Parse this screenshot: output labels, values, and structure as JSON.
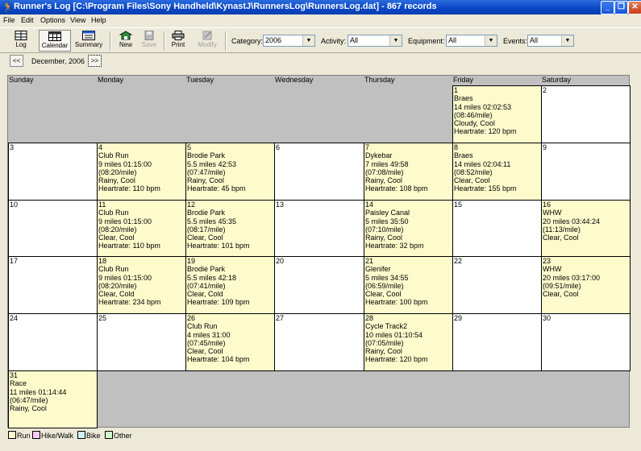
{
  "window": {
    "title": "Runner's Log [C:\\Program Files\\Sony Handheld\\KynastJ\\RunnersLog\\RunnersLog.dat] - 867 records",
    "minimize_glyph": "_",
    "maximize_glyph": "❐",
    "close_glyph": "✕"
  },
  "menu": [
    "File",
    "Edit",
    "Options",
    "View",
    "Help"
  ],
  "toolbar": {
    "log": "Log",
    "calendar": "Calendar",
    "summary": "Summary",
    "new": "New",
    "save": "Save",
    "print": "Print",
    "modify": "Modify"
  },
  "filters": {
    "category_label": "Category:",
    "category_value": "2006",
    "activity_label": "Activity:",
    "activity_value": "All",
    "equipment_label": "Equipment:",
    "equipment_value": "All",
    "events_label": "Events:",
    "events_value": "All"
  },
  "nav": {
    "prev": "<<",
    "next": ">>",
    "month_label": "December, 2006"
  },
  "days_of_week": [
    "Sunday",
    "Monday",
    "Tuesday",
    "Wednesday",
    "Thursday",
    "Friday",
    "Saturday"
  ],
  "weeks": [
    [
      null,
      null,
      null,
      null,
      null,
      {
        "day": "1",
        "run": true,
        "lines": [
          "Braes",
          "14 miles 02:02:53",
          "(08:46/mile)",
          "Cloudy, Cool",
          "Heartrate: 120 bpm"
        ]
      },
      {
        "day": "2",
        "run": false,
        "lines": []
      }
    ],
    [
      {
        "day": "3",
        "run": false,
        "lines": []
      },
      {
        "day": "4",
        "run": true,
        "lines": [
          "Club Run",
          "9 miles 01:15:00",
          "(08:20/mile)",
          "Rainy, Cool",
          "Heartrate: 110 bpm"
        ]
      },
      {
        "day": "5",
        "run": true,
        "lines": [
          "Brodie Park",
          "5.5 miles 42:53",
          "(07:47/mile)",
          "Rainy, Cool",
          "Heartrate: 45 bpm"
        ]
      },
      {
        "day": "6",
        "run": false,
        "lines": []
      },
      {
        "day": "7",
        "run": true,
        "lines": [
          "Dykebar",
          "7 miles 49:58",
          "(07:08/mile)",
          "Rainy, Cool",
          "Heartrate: 108 bpm"
        ]
      },
      {
        "day": "8",
        "run": true,
        "lines": [
          "Braes",
          "14 miles 02:04:11",
          "(08:52/mile)",
          "Clear, Cool",
          "Heartrate: 155 bpm"
        ]
      },
      {
        "day": "9",
        "run": false,
        "lines": []
      }
    ],
    [
      {
        "day": "10",
        "run": false,
        "lines": []
      },
      {
        "day": "11",
        "run": true,
        "lines": [
          "Club Run",
          "9 miles 01:15:00",
          "(08:20/mile)",
          "Clear, Cool",
          "Heartrate: 110 bpm"
        ]
      },
      {
        "day": "12",
        "run": true,
        "lines": [
          "Brodie Park",
          "5.5 miles 45:35",
          "(08:17/mile)",
          "Clear, Cool",
          "Heartrate: 101 bpm"
        ]
      },
      {
        "day": "13",
        "run": false,
        "lines": []
      },
      {
        "day": "14",
        "run": true,
        "lines": [
          "Paisley Canal",
          "5 miles 35:50",
          "(07:10/mile)",
          "Rainy, Cool",
          "Heartrate: 32 bpm"
        ]
      },
      {
        "day": "15",
        "run": false,
        "lines": []
      },
      {
        "day": "16",
        "run": true,
        "lines": [
          "WHW",
          "20 miles 03:44:24",
          "(11:13/mile)",
          "Clear, Cool"
        ]
      }
    ],
    [
      {
        "day": "17",
        "run": false,
        "lines": []
      },
      {
        "day": "18",
        "run": true,
        "lines": [
          "Club Run",
          "9 miles 01:15:00",
          "(08:20/mile)",
          "Clear, Cold",
          "Heartrate: 234 bpm"
        ]
      },
      {
        "day": "19",
        "run": true,
        "lines": [
          "Brodie Park",
          "5.5 miles 42:18",
          "(07:41/mile)",
          "Clear, Cold",
          "Heartrate: 109 bpm"
        ]
      },
      {
        "day": "20",
        "run": false,
        "lines": []
      },
      {
        "day": "21",
        "run": true,
        "lines": [
          "Glenifer",
          "5 miles 34:55",
          "(06:59/mile)",
          "Clear, Cool",
          "Heartrate: 100 bpm"
        ]
      },
      {
        "day": "22",
        "run": false,
        "lines": []
      },
      {
        "day": "23",
        "run": true,
        "lines": [
          "WHW",
          "20 miles 03:17:00",
          "(09:51/mile)",
          "Clear, Cool"
        ]
      }
    ],
    [
      {
        "day": "24",
        "run": false,
        "lines": []
      },
      {
        "day": "25",
        "run": false,
        "lines": []
      },
      {
        "day": "26",
        "run": true,
        "lines": [
          "Club Run",
          "4 miles 31:00",
          "(07:45/mile)",
          "Clear, Cool",
          "Heartrate: 104 bpm"
        ]
      },
      {
        "day": "27",
        "run": false,
        "lines": []
      },
      {
        "day": "28",
        "run": true,
        "lines": [
          "Cycle Track2",
          "10 miles 01:10:54",
          "(07:05/mile)",
          "Rainy, Cool",
          "Heartrate: 120 bpm"
        ]
      },
      {
        "day": "29",
        "run": false,
        "lines": []
      },
      {
        "day": "30",
        "run": false,
        "lines": []
      }
    ],
    [
      {
        "day": "31",
        "run": true,
        "lines": [
          "Race",
          "11 miles 01:14:44",
          "(06:47/mile)",
          "Rainy, Cool"
        ]
      },
      null,
      null,
      null,
      null,
      null,
      null
    ]
  ],
  "legend": [
    {
      "label": "Run",
      "color": "#fdfbcc"
    },
    {
      "label": "Hike/Walk",
      "color": "#f7ccf5"
    },
    {
      "label": "Bike",
      "color": "#ccf6f8"
    },
    {
      "label": "Other",
      "color": "#d3f8cc"
    }
  ],
  "colors": {
    "run_cell": "#fdfbcc",
    "empty_area": "#c0c0c0",
    "titlebar": "#0a47c7"
  }
}
